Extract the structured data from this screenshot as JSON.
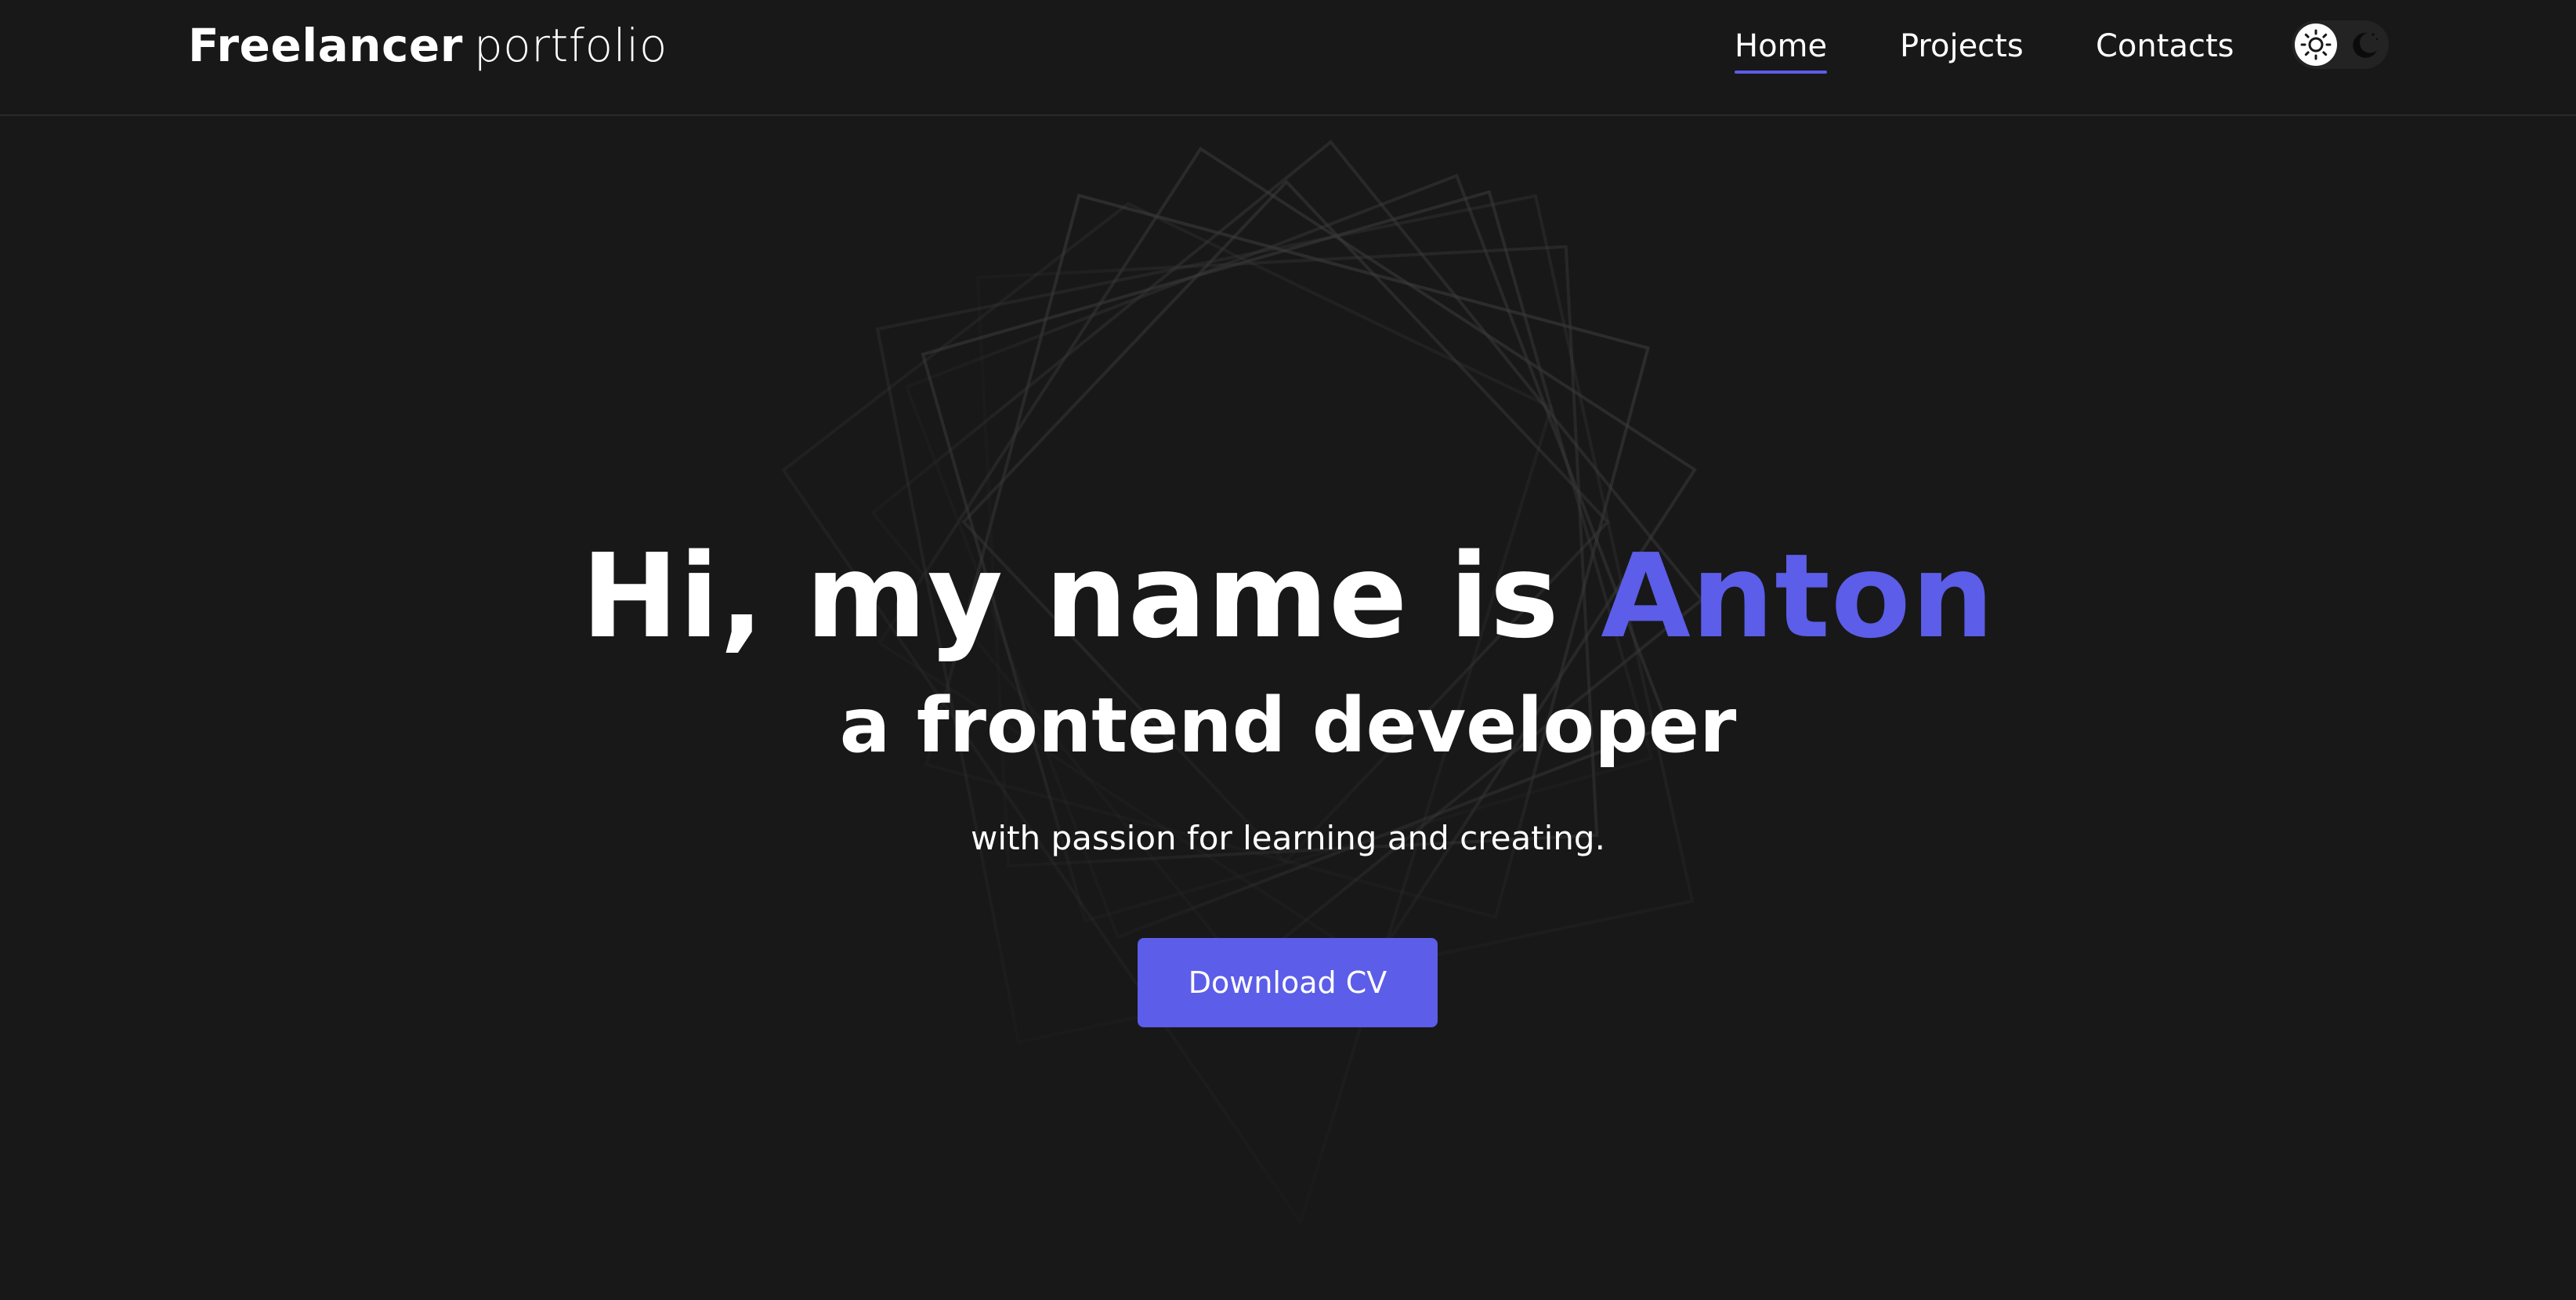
{
  "header": {
    "logo_bold": "Freelancer",
    "logo_light": "portfolio",
    "nav": [
      {
        "label": "Home",
        "active": true
      },
      {
        "label": "Projects",
        "active": false
      },
      {
        "label": "Contacts",
        "active": false
      }
    ],
    "theme_toggle": {
      "light_icon": "sun-icon",
      "dark_icon": "moon-icon",
      "selected": "light"
    }
  },
  "hero": {
    "greeting": "Hi, my name is",
    "name": "Anton",
    "role": "a frontend developer",
    "tagline": "with passion for learning and creating.",
    "cta_label": "Download CV"
  },
  "colors": {
    "background": "#181818",
    "accent": "#5c5de8",
    "text": "#ffffff",
    "divider": "#2a2a2a"
  }
}
